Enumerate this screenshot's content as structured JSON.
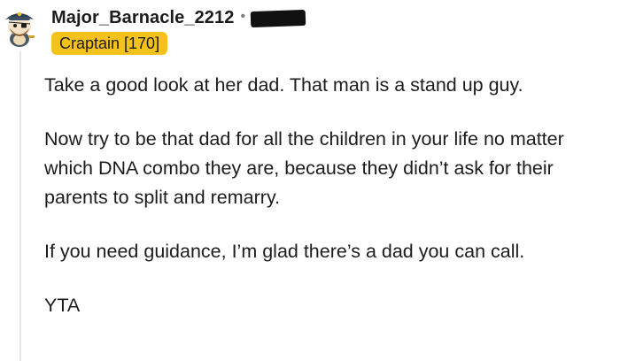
{
  "comment": {
    "author": {
      "username": "Major_Barnacle_2212",
      "separator": "•",
      "flair": "Craptain [170]",
      "avatar_icon": "pirate-snoo-avatar-icon"
    },
    "timestamp_redacted": true,
    "paragraphs": [
      "Take a good look at her dad. That man is a stand up guy.",
      "Now try to be that dad for all the children in your life no matter which DNA combo they are, because they didn’t ask for their parents to split and remarry.",
      "If you need guidance, I’m glad there’s a dad you can call.",
      "YTA"
    ],
    "colors": {
      "flair_bg": "#f5c21b",
      "text": "#1c1c1c",
      "thread_line": "#e4e6e8",
      "redaction": "#111111"
    }
  }
}
